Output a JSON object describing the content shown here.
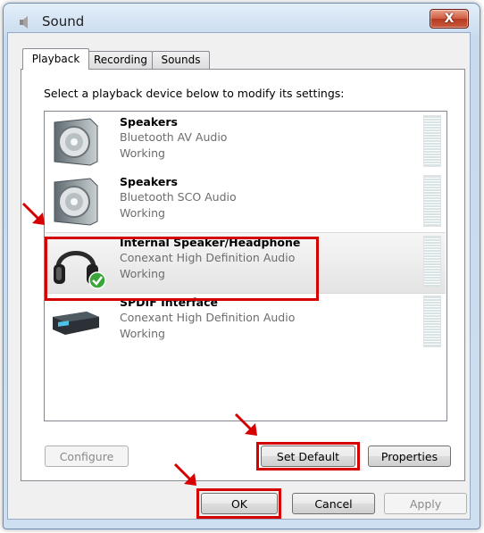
{
  "window": {
    "title": "Sound",
    "close_label": "X"
  },
  "tabs": [
    {
      "label": "Playback",
      "active": true
    },
    {
      "label": "Recording",
      "active": false
    },
    {
      "label": "Sounds",
      "active": false
    }
  ],
  "prompt": "Select a playback device below to modify its settings:",
  "devices": [
    {
      "name": "Speakers",
      "description": "Bluetooth AV Audio",
      "status": "Working",
      "icon": "speaker-icon",
      "selected": false
    },
    {
      "name": "Speakers",
      "description": "Bluetooth SCO Audio",
      "status": "Working",
      "icon": "speaker-icon",
      "selected": false
    },
    {
      "name": "Internal Speaker/Headphone",
      "description": "Conexant High Definition Audio",
      "status": "Working",
      "icon": "headphone-icon",
      "selected": true,
      "is_default": true
    },
    {
      "name": "SPDIF Interface",
      "description": "Conexant High Definition Audio",
      "status": "Working",
      "icon": "spdif-device-icon",
      "selected": false
    }
  ],
  "buttons": {
    "configure": "Configure",
    "set_default": "Set Default",
    "properties": "Properties",
    "ok": "OK",
    "cancel": "Cancel",
    "apply": "Apply"
  },
  "colors": {
    "highlight": "#d50000",
    "accent_check": "#3aa63a"
  }
}
